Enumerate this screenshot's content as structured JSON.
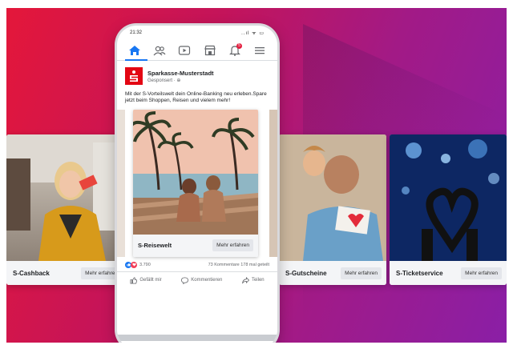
{
  "status_bar": {
    "time": "21:32",
    "signal": "..ıl ᯤ ▭"
  },
  "nav": {
    "items": [
      "home-icon",
      "friends-icon",
      "watch-icon",
      "marketplace-icon",
      "notifications-icon",
      "menu-icon"
    ],
    "notification_count": "5",
    "accent": "#1877f2"
  },
  "post": {
    "page_name": "Sparkasse-Musterstadt",
    "sponsored": "Gesponsert · ⊕",
    "text": "Mit der S-Vorteilswelt dein Online-Banking neu erleben.Spare jetzt beim Shoppen, Reisen und vielem mehr!",
    "brand_color": "#e30613"
  },
  "carousel": {
    "cards": [
      {
        "label": "S-Cashback",
        "button": "Mehr erfahren"
      },
      {
        "label": "S-Reisewelt",
        "button": "Mehr erfahren"
      },
      {
        "label": "S-Gutscheine",
        "button": "Mehr erfahren"
      },
      {
        "label": "S-Ticketservice",
        "button": "Mehr erfahren"
      }
    ]
  },
  "engagement": {
    "reaction_count": "3.790",
    "comments_shares": "73 Kommentare 178 mal geteilt"
  },
  "actions": {
    "like": "Gefällt mir",
    "comment": "Kommentieren",
    "share": "Teilen"
  }
}
